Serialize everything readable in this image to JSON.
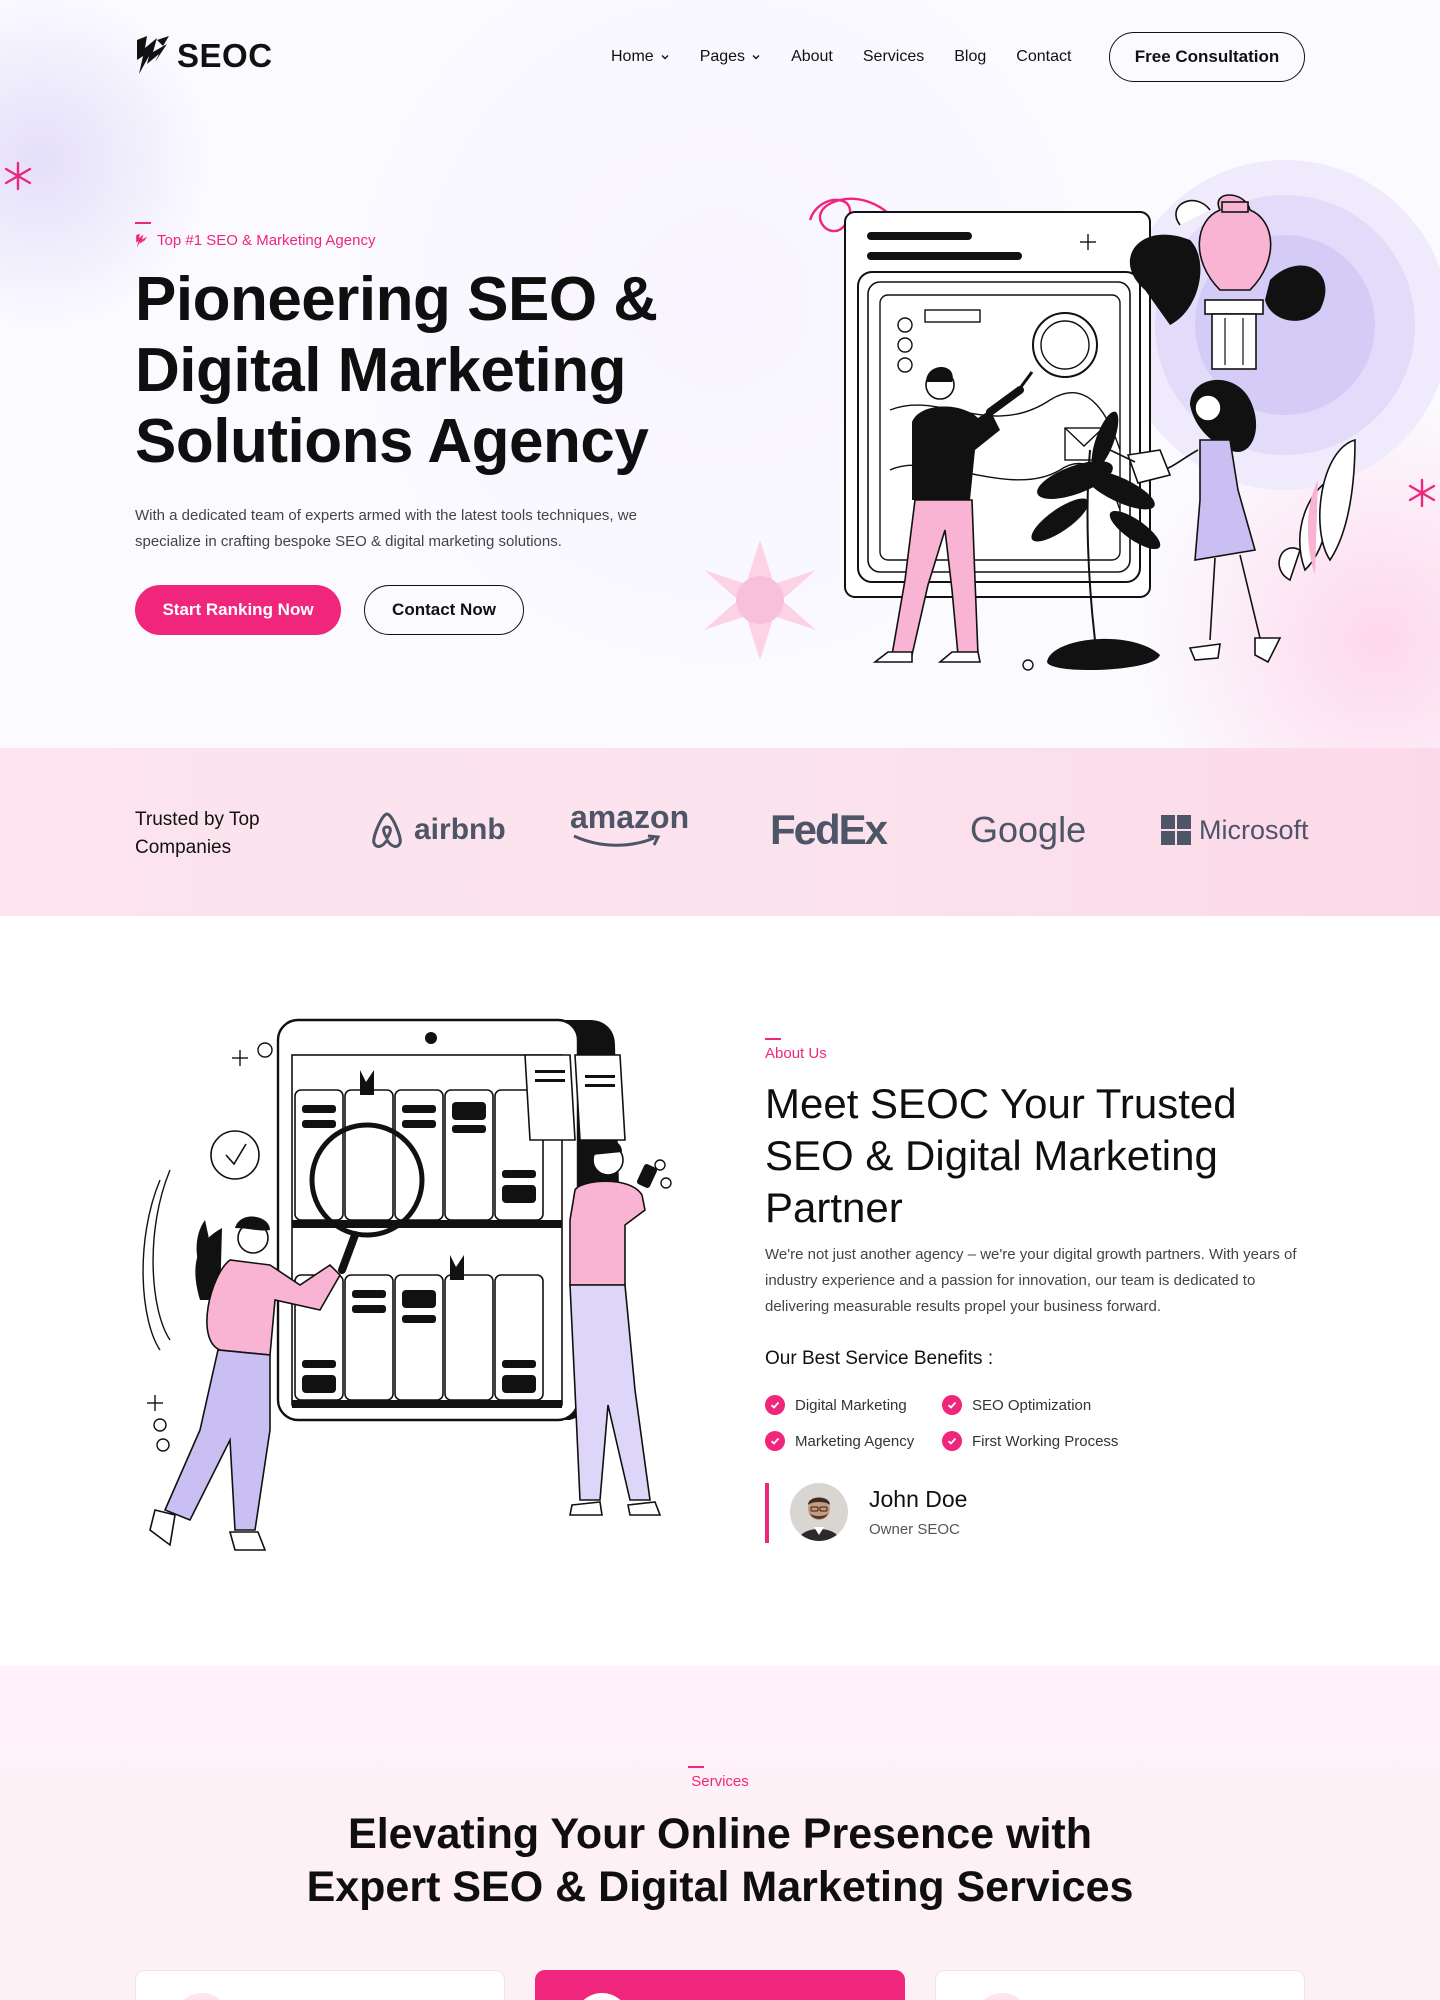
{
  "header": {
    "logo_text": "SEOC",
    "nav": [
      {
        "label": "Home",
        "dropdown": true
      },
      {
        "label": "Pages",
        "dropdown": true
      },
      {
        "label": "About",
        "dropdown": false
      },
      {
        "label": "Services",
        "dropdown": false
      },
      {
        "label": "Blog",
        "dropdown": false
      },
      {
        "label": "Contact",
        "dropdown": false
      }
    ],
    "cta_label": "Free Consultation"
  },
  "hero": {
    "eyebrow": "Top #1 SEO & Marketing Agency",
    "title": "Pioneering SEO & Digital Marketing Solutions Agency",
    "description": "With a dedicated team of experts armed with the latest tools  techniques, we specialize in crafting bespoke SEO & digital marketing solutions.",
    "primary_button": "Start Ranking Now",
    "secondary_button": "Contact Now"
  },
  "trusted": {
    "label": "Trusted by Top Companies",
    "brands": [
      "airbnb",
      "amazon",
      "FedEx",
      "Google",
      "Microsoft"
    ]
  },
  "about": {
    "eyebrow": "About Us",
    "title": "Meet SEOC Your Trusted SEO & Digital Marketing Partner",
    "description": "We're not just another agency – we're your digital growth partners. With years of industry experience and a passion for innovation, our team is dedicated to delivering measurable results  propel your business forward.",
    "benefits_title": "Our Best Service Benefits :",
    "benefits": [
      "Digital Marketing",
      "SEO Optimization",
      "Marketing Agency",
      "First Working Process"
    ],
    "owner": {
      "name": "John Doe",
      "role": "Owner SEOC"
    }
  },
  "services": {
    "eyebrow": "Services",
    "title": "Elevating Your Online Presence with Expert SEO & Digital Marketing Services"
  },
  "colors": {
    "accent": "#f0267c",
    "text": "#0f0f0f",
    "brand_gray": "#4d5566",
    "trusted_bg": "#fde4ef",
    "lavender": "#c9bff2",
    "pink_fill": "#f8b4d2"
  },
  "icons": [
    "logo-mark-icon",
    "chevron-down-icon",
    "check-icon",
    "sparkle-icon",
    "airbnb-logo-icon",
    "microsoft-logo-icon"
  ]
}
